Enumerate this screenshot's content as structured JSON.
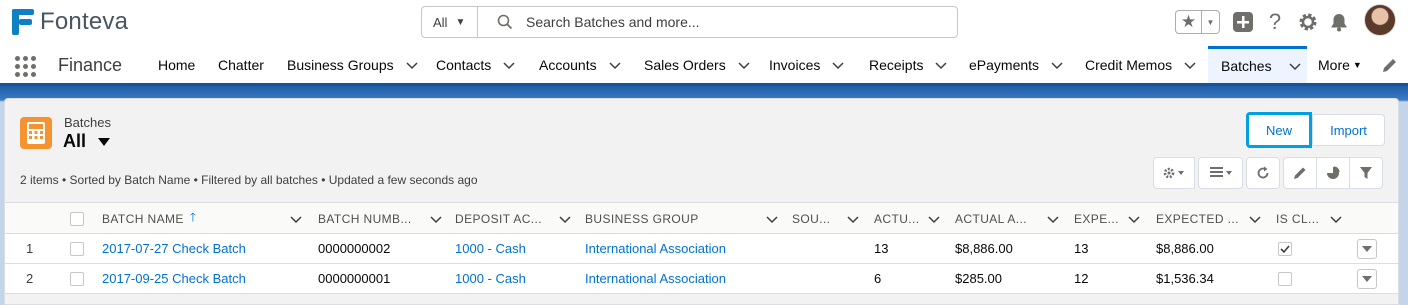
{
  "header": {
    "logo_text": "Fonteva",
    "search_scope": "All",
    "search_placeholder": "Search Batches and more..."
  },
  "nav": {
    "app_name": "Finance",
    "items": [
      {
        "label": "Home",
        "has_menu": false
      },
      {
        "label": "Chatter",
        "has_menu": false
      },
      {
        "label": "Business Groups",
        "has_menu": true
      },
      {
        "label": "Contacts",
        "has_menu": true
      },
      {
        "label": "Accounts",
        "has_menu": true
      },
      {
        "label": "Sales Orders",
        "has_menu": true
      },
      {
        "label": "Invoices",
        "has_menu": true
      },
      {
        "label": "Receipts",
        "has_menu": true
      },
      {
        "label": "ePayments",
        "has_menu": true
      },
      {
        "label": "Credit Memos",
        "has_menu": true
      },
      {
        "label": "Batches",
        "has_menu": true,
        "active": true
      },
      {
        "label": "More",
        "has_menu": true
      }
    ]
  },
  "list": {
    "object_label": "Batches",
    "view_name": "All",
    "new_button": "New",
    "import_button": "Import",
    "summary": "2 items • Sorted by Batch Name • Filtered by all batches • Updated a few seconds ago",
    "columns": [
      {
        "label": "Batch Name",
        "sorted": "asc"
      },
      {
        "label": "Batch Numb..."
      },
      {
        "label": "Deposit Ac..."
      },
      {
        "label": "Business Group"
      },
      {
        "label": "Sou..."
      },
      {
        "label": "Actu..."
      },
      {
        "label": "Actual A..."
      },
      {
        "label": "Expe..."
      },
      {
        "label": "Expected ..."
      },
      {
        "label": "Is Cl..."
      }
    ],
    "rows": [
      {
        "index": "1",
        "batch_name": "2017-07-27 Check Batch",
        "batch_number": "0000000002",
        "deposit_account": "1000 - Cash",
        "business_group": "International Association",
        "source": "",
        "actual_count": "13",
        "actual_amount": "$8,886.00",
        "expected_count": "13",
        "expected_amount": "$8,886.00",
        "is_closed": true
      },
      {
        "index": "2",
        "batch_name": "2017-09-25 Check Batch",
        "batch_number": "0000000001",
        "deposit_account": "1000 - Cash",
        "business_group": "International Association",
        "source": "",
        "actual_count": "6",
        "actual_amount": "$285.00",
        "expected_count": "12",
        "expected_amount": "$1,536.34",
        "is_closed": false
      }
    ]
  },
  "colors": {
    "brand_blue": "#0070d2",
    "logo_blue": "#0f7fc6",
    "object_icon": "#f59331",
    "focus_ring": "#00a1e0"
  }
}
